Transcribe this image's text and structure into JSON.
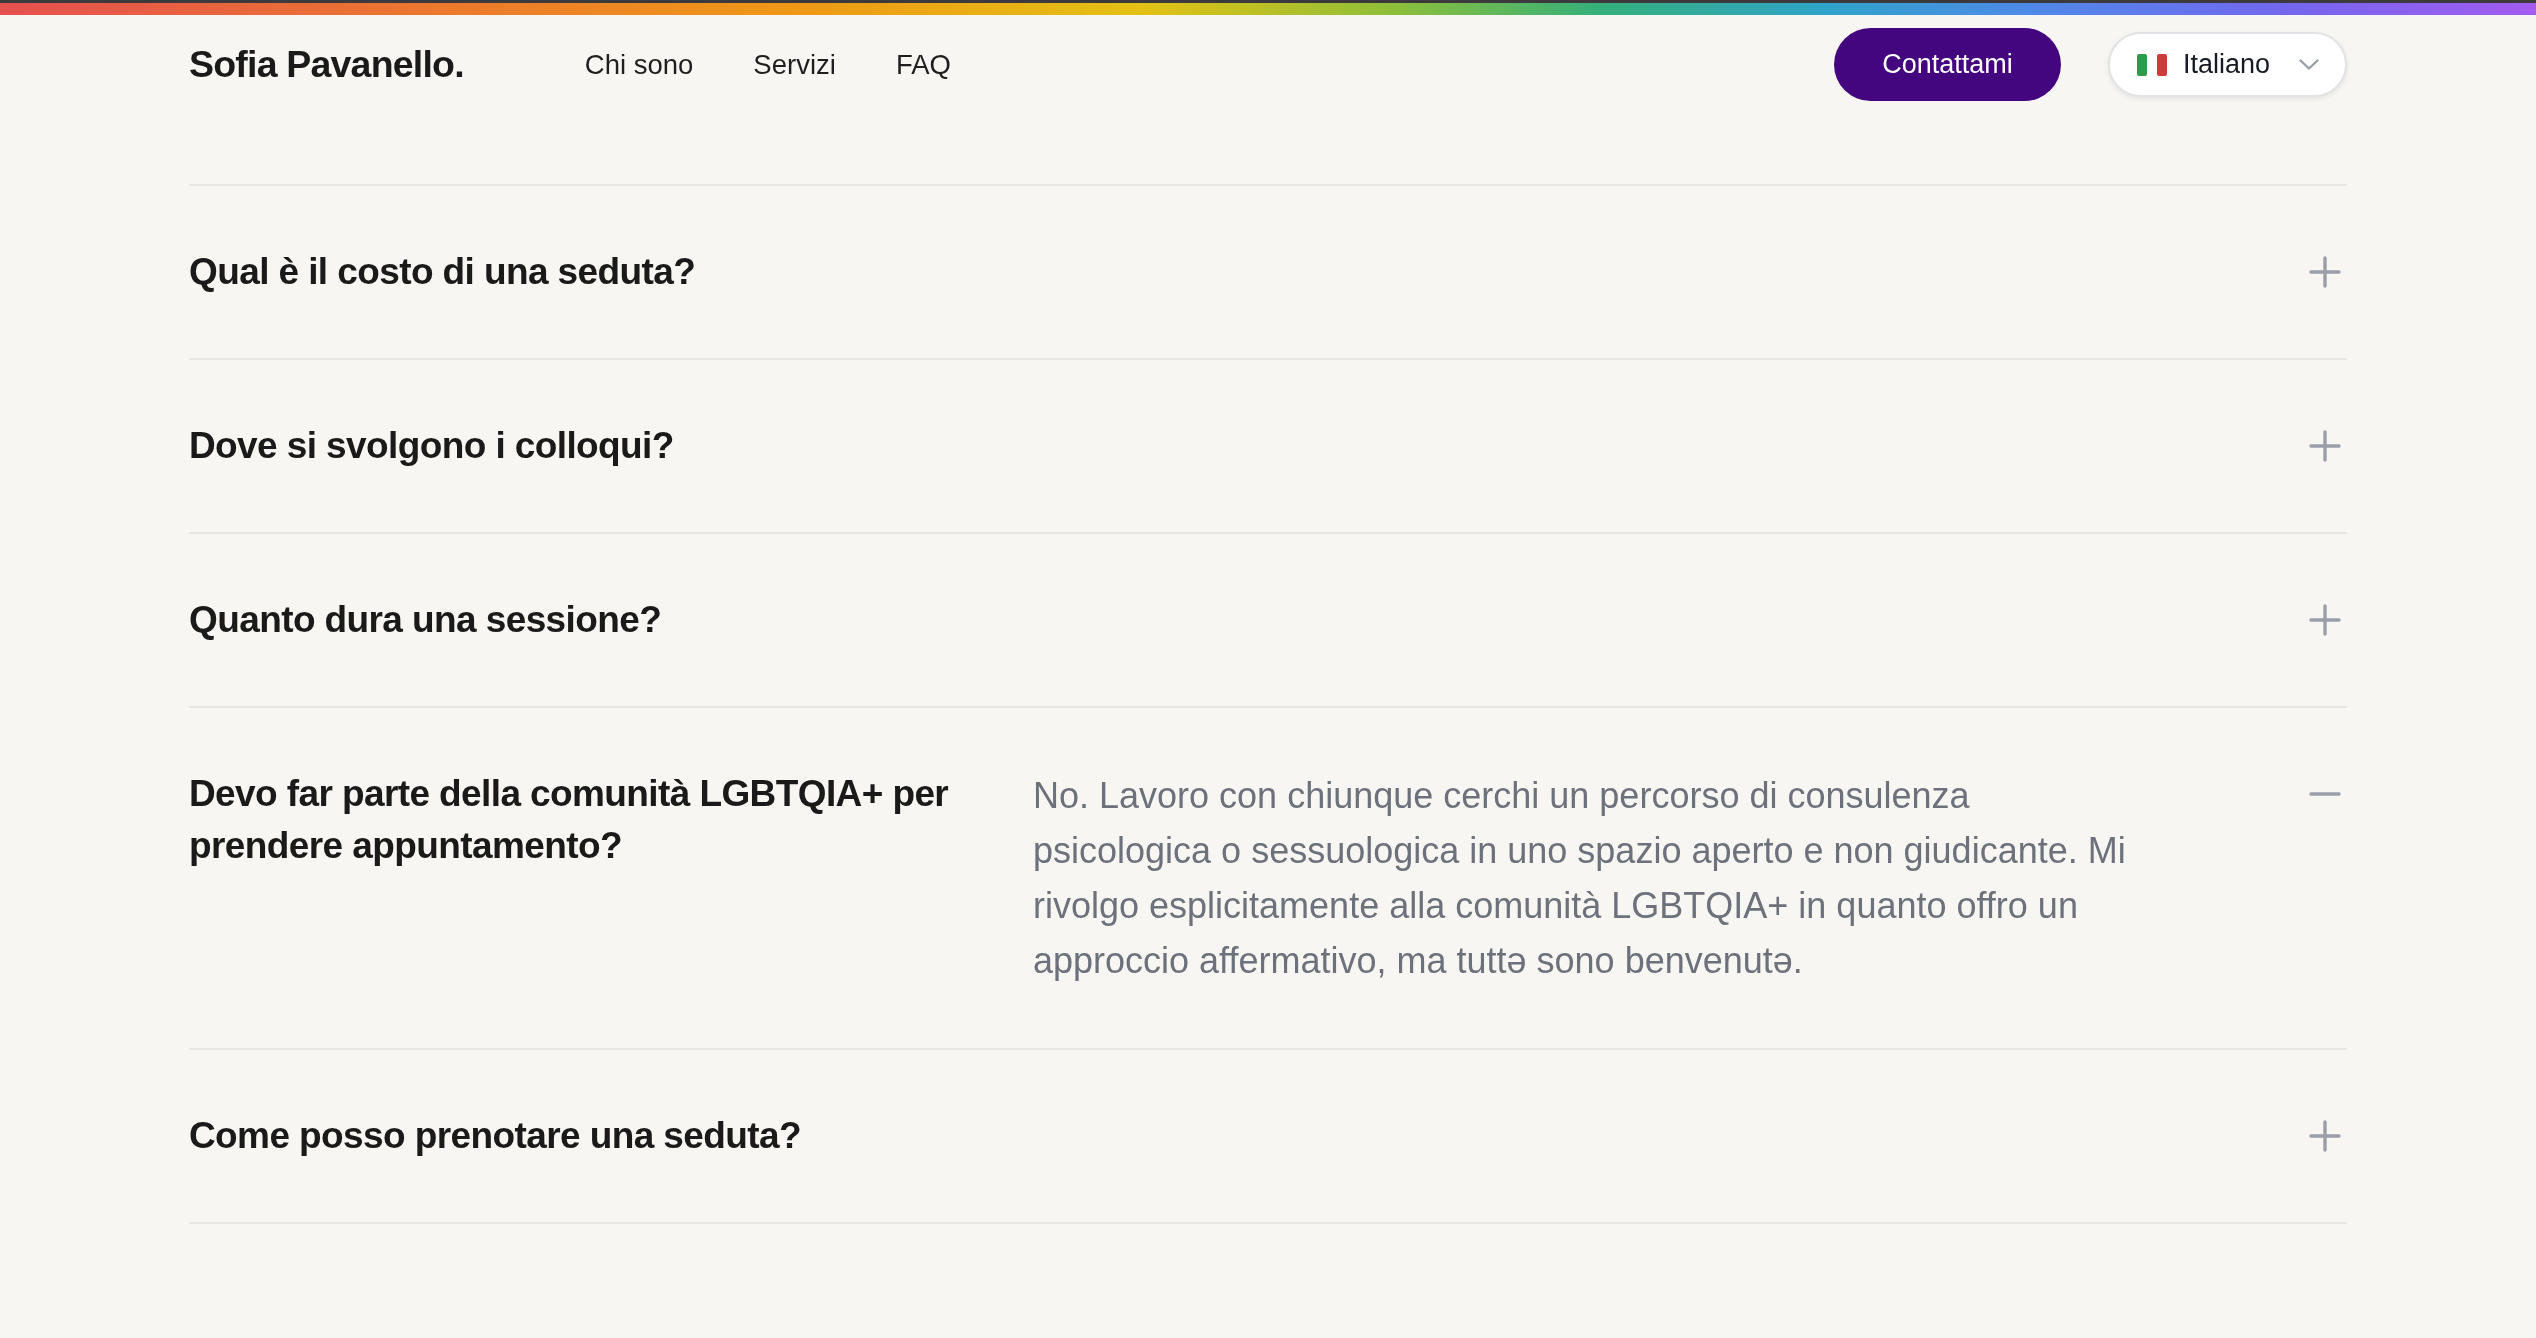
{
  "header": {
    "logo": "Sofia Pavanello.",
    "nav": [
      "Chi sono",
      "Servizi",
      "FAQ"
    ],
    "cta": "Contattami",
    "language": {
      "label": "Italiano"
    }
  },
  "faq": [
    {
      "question": "Qual è il costo di una seduta?",
      "expanded": false
    },
    {
      "question": "Dove si svolgono i colloqui?",
      "expanded": false
    },
    {
      "question": "Quanto dura una sessione?",
      "expanded": false
    },
    {
      "question": "Devo far parte della comunità LGBTQIA+ per prendere appuntamento?",
      "expanded": true,
      "answer": "No. Lavoro con chiunque cerchi un percorso di consulenza psicologica o sessuologica in uno spazio aperto e non giudicante. Mi rivolgo esplicitamente alla comunità LGBTQIA+ in quanto offro un approccio affermativo, ma tuttə sono benvenutə."
    },
    {
      "question": "Come posso prenotare una seduta?",
      "expanded": false
    }
  ]
}
